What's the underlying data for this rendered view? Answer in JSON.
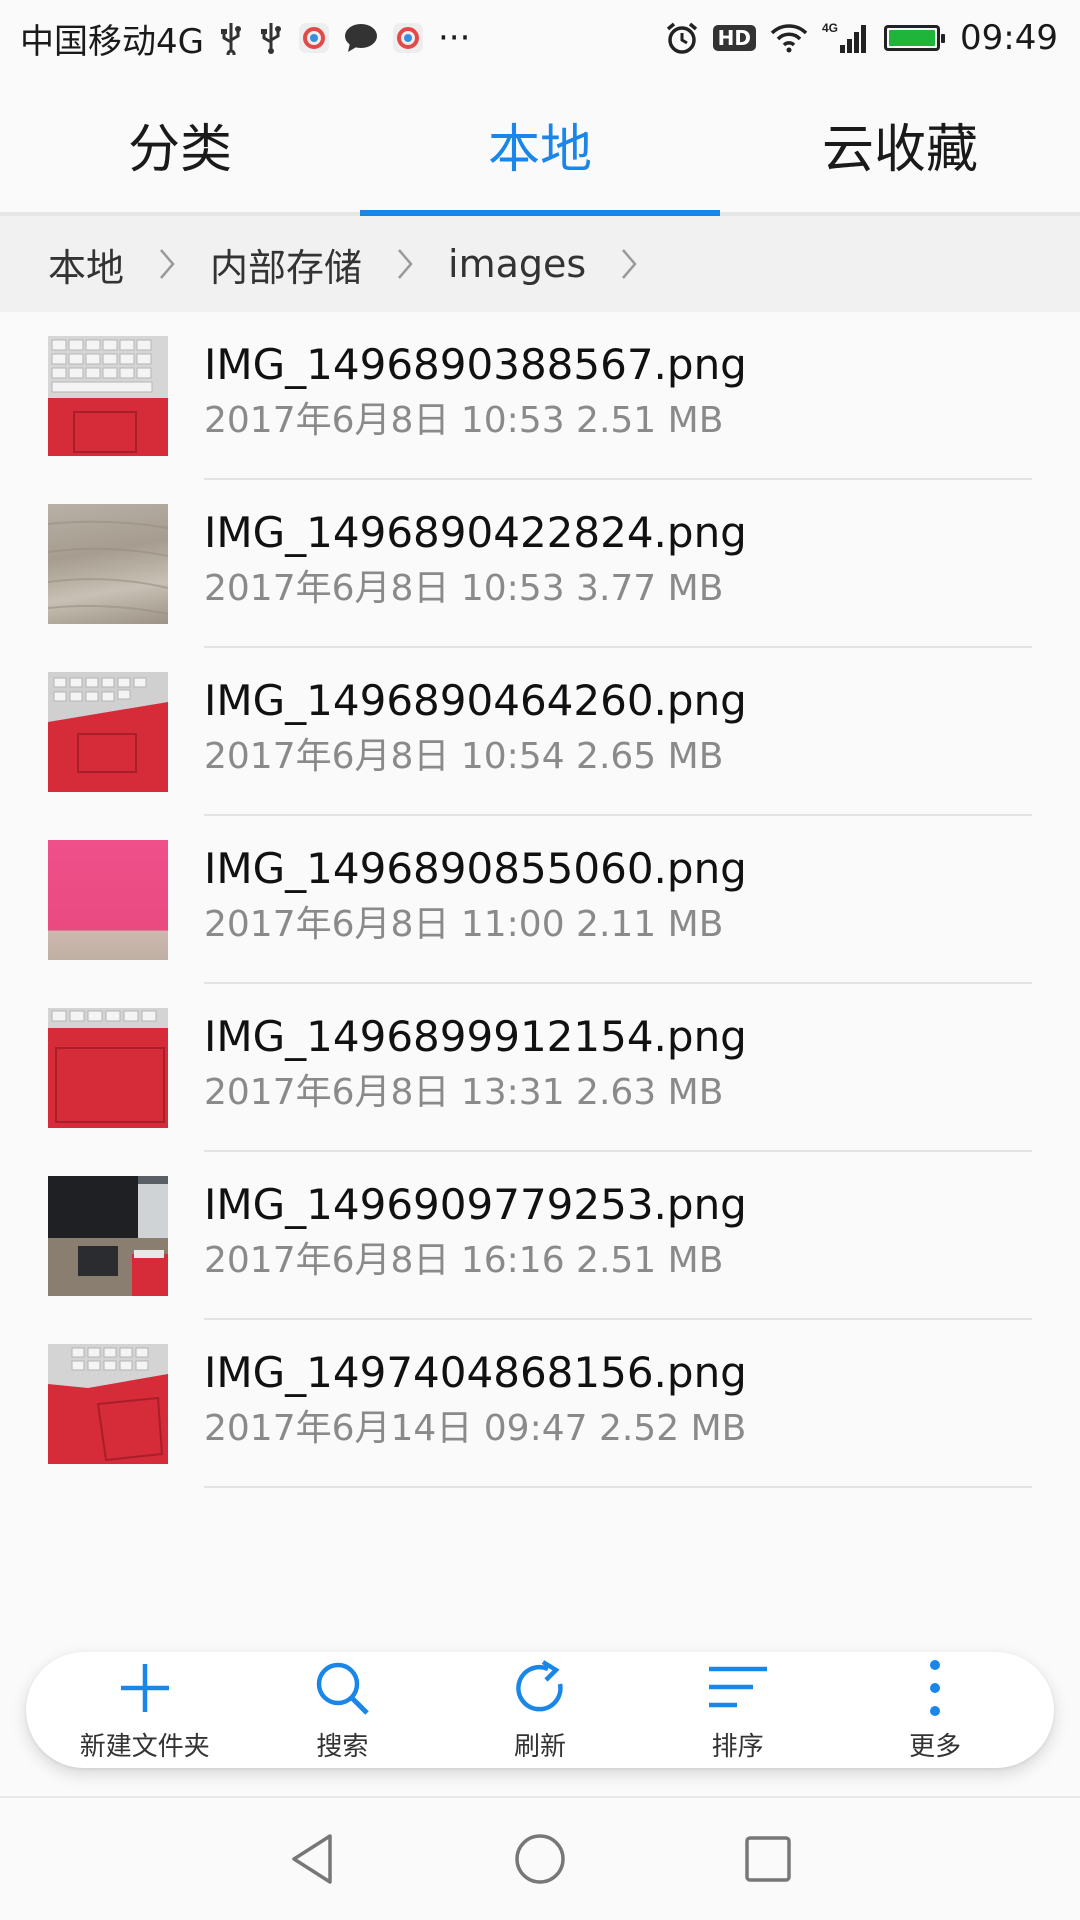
{
  "status_bar": {
    "carrier": "中国移动4G",
    "time": "09:49",
    "hd_badge": "HD",
    "network": "4G",
    "more_indicator": "···",
    "icons": [
      "usb-icon",
      "usb-icon",
      "app-icon",
      "message-icon",
      "app-icon",
      "alarm-icon",
      "wifi-icon",
      "signal-icon",
      "battery-icon"
    ]
  },
  "tabs": [
    {
      "label": "分类",
      "active": false
    },
    {
      "label": "本地",
      "active": true
    },
    {
      "label": "云收藏",
      "active": false
    }
  ],
  "breadcrumb": [
    "本地",
    "内部存储",
    "images"
  ],
  "files": [
    {
      "name": "IMG_1496890388567.png",
      "meta": "2017年6月8日 10:53 2.51 MB",
      "thumb": "keyboard-red"
    },
    {
      "name": "IMG_1496890422824.png",
      "meta": "2017年6月8日 10:53 3.77 MB",
      "thumb": "wood"
    },
    {
      "name": "IMG_1496890464260.png",
      "meta": "2017年6月8日 10:54 2.65 MB",
      "thumb": "keyboard-red"
    },
    {
      "name": "IMG_1496890855060.png",
      "meta": "2017年6月8日 11:00 2.11 MB",
      "thumb": "pink"
    },
    {
      "name": "IMG_1496899912154.png",
      "meta": "2017年6月8日 13:31 2.63 MB",
      "thumb": "keyboard-red"
    },
    {
      "name": "IMG_1496909779253.png",
      "meta": "2017年6月8日 16:16 2.51 MB",
      "thumb": "desk"
    },
    {
      "name": "IMG_1497404868156.png",
      "meta": "2017年6月14日 09:47 2.52 MB",
      "thumb": "keyboard-red"
    }
  ],
  "toolbar": {
    "new_folder": "新建文件夹",
    "search": "搜索",
    "refresh": "刷新",
    "sort": "排序",
    "more": "更多"
  },
  "colors": {
    "accent": "#1a87e8",
    "battery": "#1fb53b"
  }
}
